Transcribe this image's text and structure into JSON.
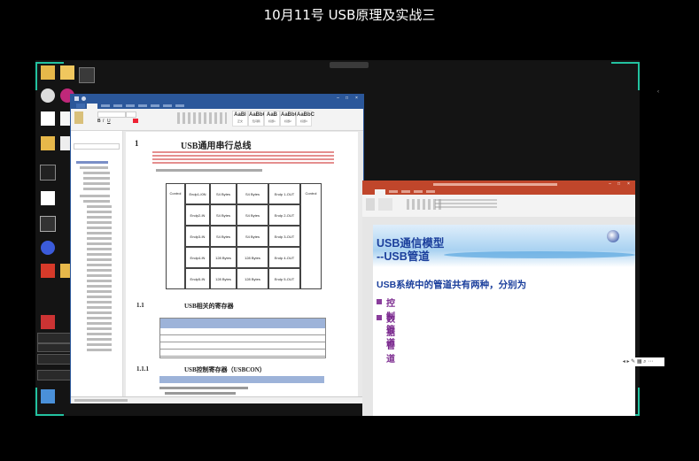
{
  "video_title": "10月11号 USB原理及实战三",
  "word": {
    "heading_number": "1",
    "heading_text": "USB通用串行总线",
    "table_col_header": "Control",
    "table_rows": [
      [
        "Control",
        "Endp1-I0N",
        "S4 Bytes",
        "S4 Bytes",
        "Endp 1-OUT",
        "Control"
      ],
      [
        "",
        "Endp2-IN",
        "S4 Bytes",
        "S4 Bytes",
        "Endp 2-OUT",
        ""
      ],
      [
        "",
        "Endp3-IN",
        "S4 Bytes",
        "S4 Bytes",
        "Endp 3-OUT",
        ""
      ],
      [
        "",
        "Endp4-IN",
        "128 Bytes",
        "128 Bytes",
        "Endp 4-OUT",
        ""
      ],
      [
        "",
        "Endp5-IN",
        "128 Bytes",
        "128 Bytes",
        "Endp 5-OUT",
        ""
      ]
    ],
    "section_1_1_num": "1.1",
    "section_1_1_text": "USB相关的寄存器",
    "section_1_1_1_num": "1.1.1",
    "section_1_1_1_text": "USB控制寄存器（USBCON）"
  },
  "ppt": {
    "slide_title_line1": "USB通信模型",
    "slide_title_line2": "--USB管道",
    "slide_subtitle": "USB系统中的管道共有两种，分别为",
    "bullets": [
      "控制管道",
      "数据管道"
    ]
  },
  "colors": {
    "accent_corner": "#23c2a0",
    "word_blue": "#2b579a",
    "ppt_orange": "#c0462b",
    "slide_blue": "#1b3f9c",
    "slide_purple": "#7b2a8f"
  }
}
